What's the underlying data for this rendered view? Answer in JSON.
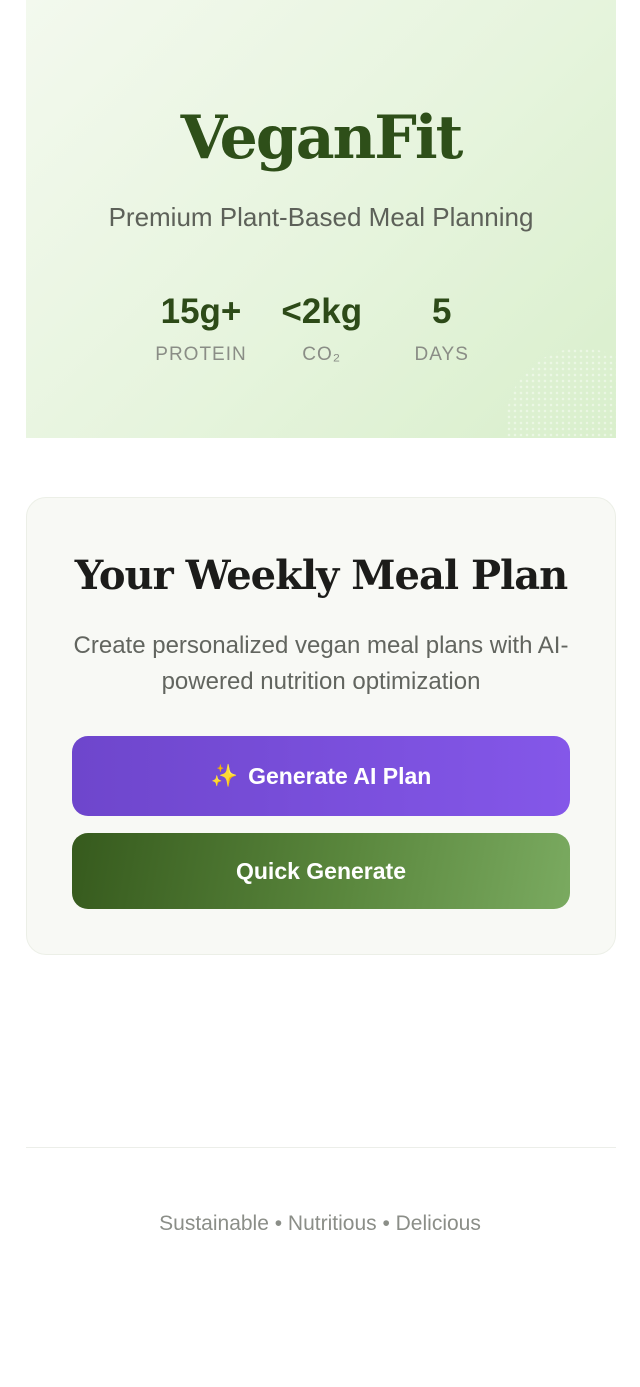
{
  "hero": {
    "brand": "VeganFit",
    "tagline": "Premium Plant-Based Meal Planning",
    "stats": [
      {
        "value": "15g+",
        "label": "PROTEIN"
      },
      {
        "value": "<2kg",
        "label": "CO₂"
      },
      {
        "value": "5",
        "label": "DAYS"
      }
    ]
  },
  "plan_card": {
    "title": "Your Weekly Meal Plan",
    "description": "Create personalized vegan meal plans with AI-powered nutrition optimization",
    "ai_button": {
      "icon": "sparkles-icon",
      "label": "Generate AI Plan"
    },
    "quick_button": {
      "label": "Quick Generate"
    }
  },
  "footer": {
    "text": "Sustainable • Nutritious • Delicious"
  },
  "colors": {
    "brand_green": "#2e4f19",
    "ai_purple": "#7a50de",
    "quick_green": "#4a7430"
  }
}
